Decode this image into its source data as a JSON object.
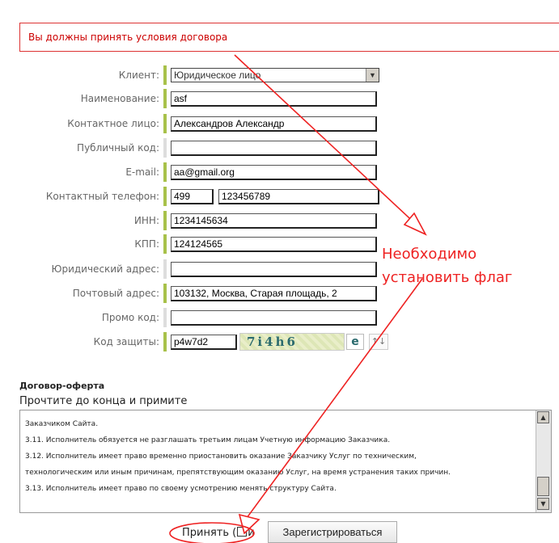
{
  "error": {
    "message": "Вы должны принять условия договора"
  },
  "form": {
    "client": {
      "label": "Клиент:",
      "value": "Юридическое лицо"
    },
    "name": {
      "label": "Наименование:",
      "value": "asf"
    },
    "contact_person": {
      "label": "Контактное лицо:",
      "value": "Александров Александр"
    },
    "public_code": {
      "label": "Публичный код:",
      "value": ""
    },
    "email": {
      "label": "E-mail:",
      "value": "aa@gmail.org"
    },
    "phone": {
      "label": "Контактный телефон:",
      "code": "499",
      "number": "123456789"
    },
    "inn": {
      "label": "ИНН:",
      "value": "1234145634"
    },
    "kpp": {
      "label": "КПП:",
      "value": "124124565"
    },
    "legal_address": {
      "label": "Юридический адрес:",
      "value": ""
    },
    "postal_address": {
      "label": "Почтовый адрес:",
      "value": "103132, Москва, Старая площадь, 2"
    },
    "promo_code": {
      "label": "Промо код:",
      "value": ""
    },
    "captcha": {
      "label": "Код защиты:",
      "value": "p4w7d2",
      "image_text": "7i4h6",
      "extra_glyph": "e",
      "swap_label": "↑↓"
    }
  },
  "offer": {
    "title": "Договор-оферта",
    "subtitle": "Прочтите до конца и примите",
    "lines": [
      "Заказчиком Сайта.",
      "3.11. Исполнитель обязуется не разглашать третьим лицам Учетную информацию Заказчика.",
      "3.12. Исполнитель имеет право временно приостановить оказание Заказчику Услуг по техническим,",
      "технологическим или иным причинам, препятствующим оказанию Услуг, на время устранения таких причин.",
      "3.13. Исполнитель имеет право по своему усмотрению менять структуру Сайта."
    ]
  },
  "accept": {
    "label_prefix": "Принять (",
    "label_suffix": "и"
  },
  "register_button": {
    "label": "Зарегистрироваться"
  },
  "annotation": {
    "line1": "Необходимо",
    "line2": "установить флаг"
  },
  "colors": {
    "annotation": "#ee2222",
    "error": "#cc0000",
    "required_bar": "#a8c14a"
  }
}
